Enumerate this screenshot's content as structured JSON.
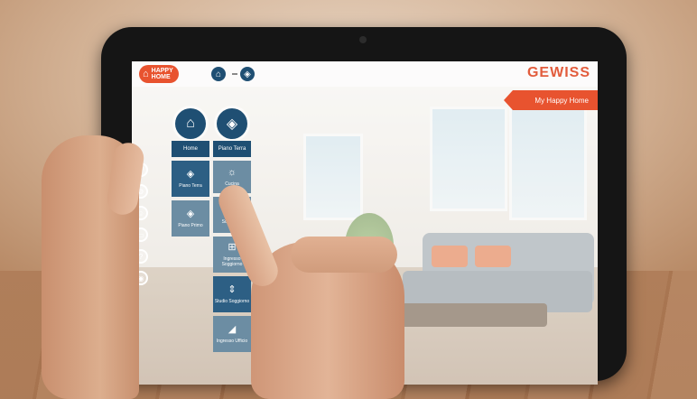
{
  "header": {
    "logo_line1": "HAPPY",
    "logo_line2": "HOME",
    "brand": "GEWISS",
    "ribbon": "My Happy Home",
    "nav": [
      {
        "icon": "home-icon",
        "glyph": "⌂"
      },
      {
        "icon": "layers-icon",
        "glyph": "◈"
      }
    ]
  },
  "menu": {
    "col1": {
      "head_icon": "home-icon",
      "label": "Home",
      "tiles": [
        {
          "icon": "layers-icon",
          "glyph": "◈",
          "label": "Piano Terra"
        },
        {
          "icon": "layers-icon",
          "glyph": "◈",
          "label": "Piano Primo"
        }
      ]
    },
    "col2": {
      "head_icon": "layers-icon",
      "label": "Piano Terra",
      "tiles": [
        {
          "icon": "bulb-icon",
          "glyph": "☼",
          "label": "Cucina"
        },
        {
          "icon": "grid-icon",
          "glyph": "▦",
          "label": "Soggiorno"
        },
        {
          "icon": "window-icon",
          "glyph": "⊞",
          "label": "Ingresso Soggiorno"
        },
        {
          "icon": "blind-icon",
          "glyph": "⇕",
          "label": "Studio Soggiorno"
        },
        {
          "icon": "signal-icon",
          "glyph": "◢",
          "label": "Ingresso Ufficio"
        }
      ]
    }
  },
  "side_icons": [
    "power-icon",
    "settings-icon",
    "user-icon",
    "screen-icon",
    "help-icon",
    "camera-icon"
  ],
  "colors": {
    "accent": "#e8532f",
    "menu_blue": "#1f4f73",
    "tile_blue": "#2d5f84"
  }
}
